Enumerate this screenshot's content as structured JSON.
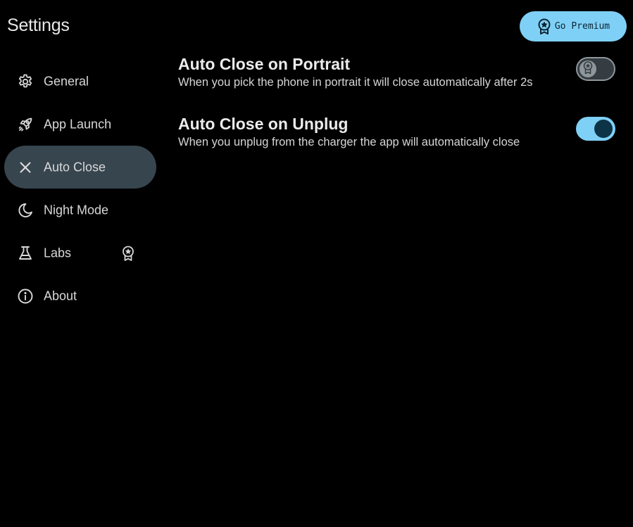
{
  "header": {
    "title": "Settings",
    "premium_label": "Go Premium"
  },
  "sidebar": {
    "items": [
      {
        "label": "General",
        "icon": "gear-icon",
        "active": false
      },
      {
        "label": "App Launch",
        "icon": "rocket-icon",
        "active": false
      },
      {
        "label": "Auto Close",
        "icon": "close-icon",
        "active": true
      },
      {
        "label": "Night Mode",
        "icon": "moon-icon",
        "active": false
      },
      {
        "label": "Labs",
        "icon": "flask-icon",
        "active": false,
        "badge": "premium-badge-icon"
      },
      {
        "label": "About",
        "icon": "info-icon",
        "active": false
      }
    ]
  },
  "settings": [
    {
      "title": "Auto Close on Portrait",
      "description": "When you pick the phone in portrait it will close automatically after 2s",
      "enabled": false,
      "locked": true
    },
    {
      "title": "Auto Close on Unplug",
      "description": "When you unplug from the charger the app will automatically close",
      "enabled": true,
      "locked": false
    }
  ],
  "colors": {
    "background": "#000000",
    "accent": "#7fd0f6",
    "active_nav": "#37454f",
    "knob_on": "#0d3347"
  }
}
